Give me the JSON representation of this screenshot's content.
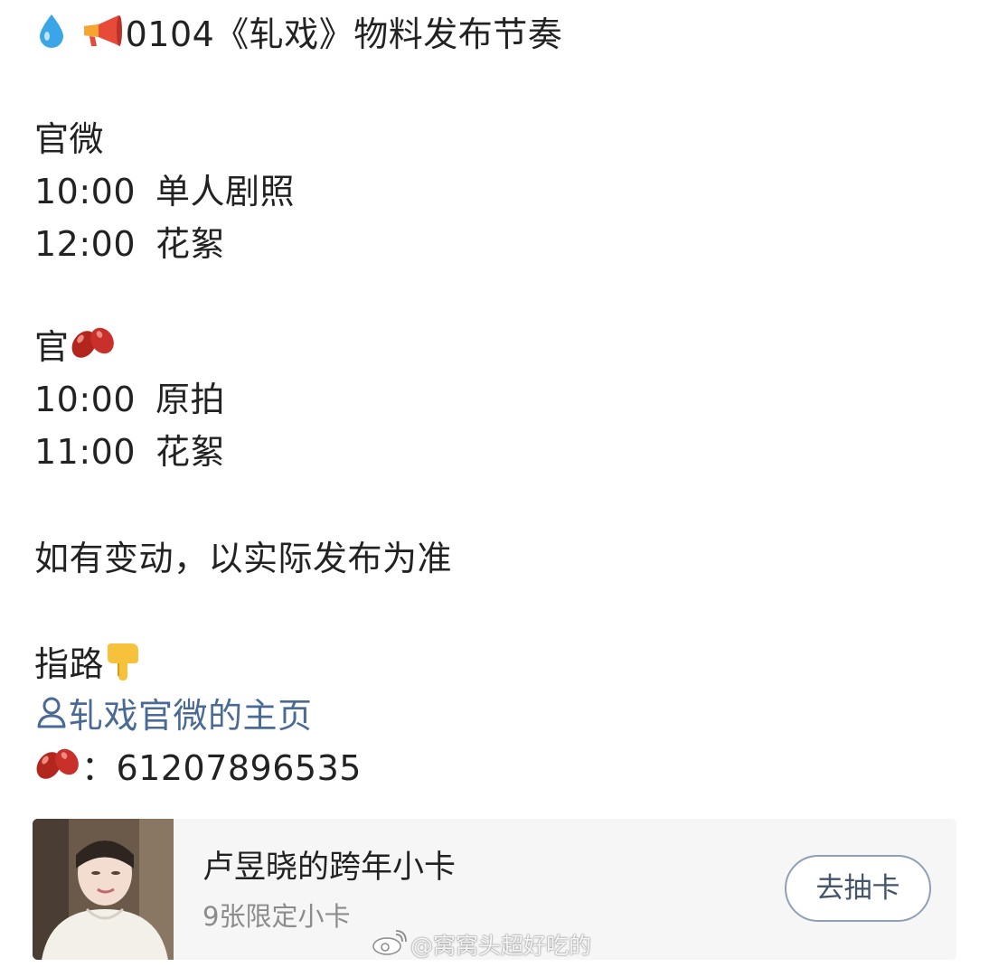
{
  "post": {
    "title_text": "0104《轧戏》物料发布节奏",
    "title_icons": [
      "droplet-icon",
      "megaphone-icon"
    ],
    "section1": {
      "heading": "官微",
      "rows": [
        {
          "time": "10:00",
          "item": "单人剧照"
        },
        {
          "time": "12:00",
          "item": "花絮"
        }
      ]
    },
    "section2": {
      "heading": "官",
      "heading_icon": "red-bean-icon",
      "rows": [
        {
          "time": "10:00",
          "item": "原拍"
        },
        {
          "time": "11:00",
          "item": "花絮"
        }
      ]
    },
    "note": "如有变动，以实际发布为准",
    "guide": {
      "label": "指路",
      "pointer_icon": "pointing-down-hand-icon",
      "profile_link": "轧戏官微的主页",
      "profile_icon": "person-icon",
      "bean_id_icon": "red-bean-icon",
      "bean_id_text": "：61207896535"
    }
  },
  "card": {
    "title": "卢昱晓的跨年小卡",
    "subtitle": "9张限定小卡",
    "button_label": "去抽卡"
  },
  "watermark": {
    "text": "@窝窝头超好吃的",
    "logo_icon": "weibo-logo-icon"
  }
}
